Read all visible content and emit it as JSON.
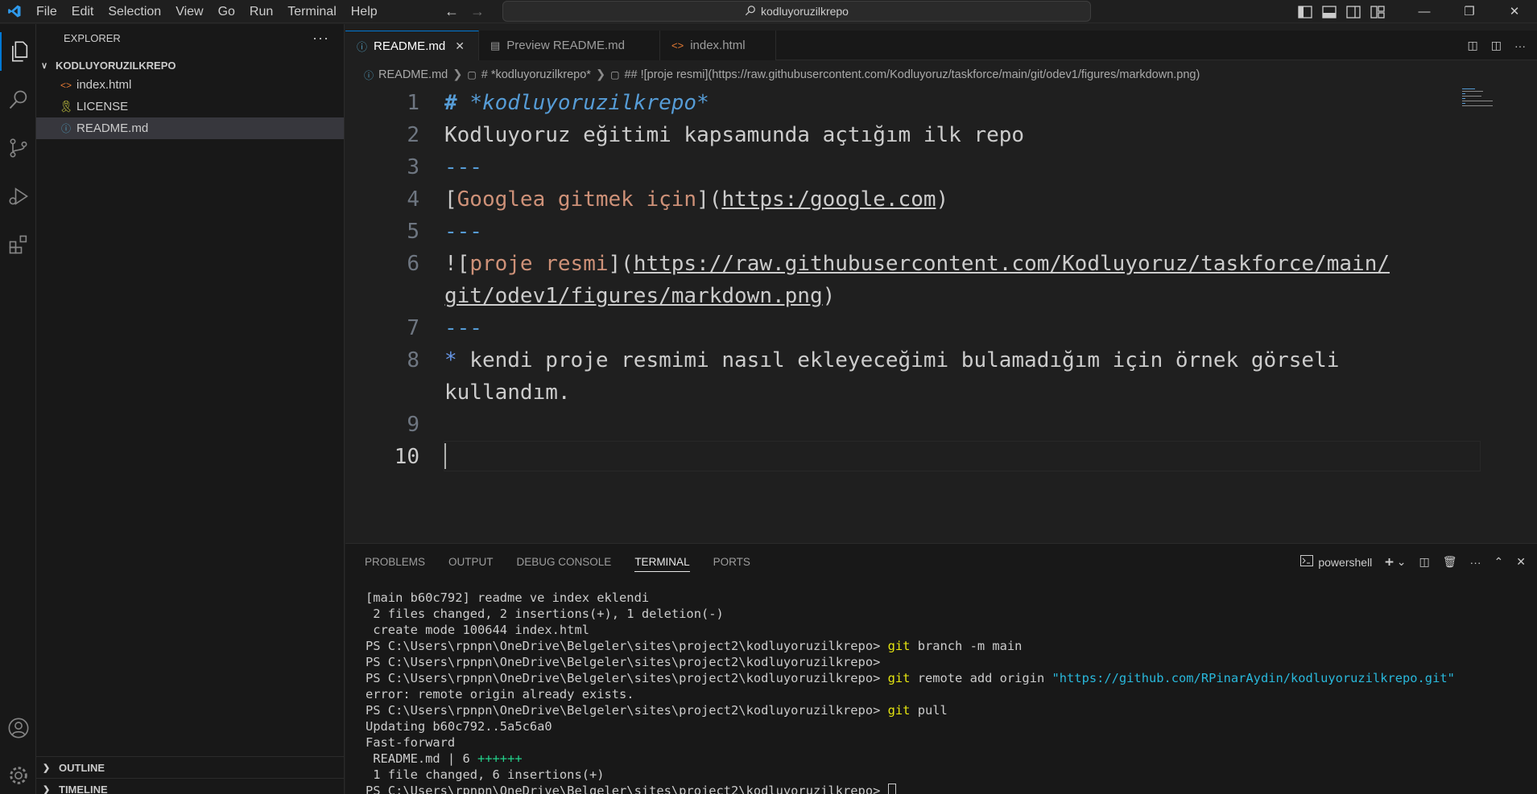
{
  "titlebar": {
    "menu": [
      "File",
      "Edit",
      "Selection",
      "View",
      "Go",
      "Run",
      "Terminal",
      "Help"
    ],
    "search_text": "kodluyoruzilkrepo",
    "icons": [
      "vscode-logo-icon",
      "arrow-left-icon",
      "arrow-right-icon",
      "search-icon",
      "toggle-primary-sidebar-icon",
      "toggle-panel-icon",
      "toggle-secondary-sidebar-icon",
      "customize-layout-icon",
      "minimize-icon",
      "restore-icon",
      "close-icon"
    ]
  },
  "activity_bar": {
    "items": [
      "explorer-icon",
      "search-icon",
      "source-control-icon",
      "run-debug-icon",
      "extensions-icon"
    ],
    "bottom": [
      "accounts-icon",
      "manage-gear-icon"
    ]
  },
  "sidebar": {
    "title": "EXPLORER",
    "folder": "KODLUYORUZILKREPO",
    "files": [
      {
        "name": "index.html",
        "icon": "html-file-icon",
        "color": "#e37933"
      },
      {
        "name": "LICENSE",
        "icon": "license-file-icon",
        "color": "#cbcb41"
      },
      {
        "name": "README.md",
        "icon": "info-file-icon",
        "color": "#519aba"
      }
    ],
    "outline": "OUTLINE",
    "timeline": "TIMELINE"
  },
  "tabs": [
    {
      "label": "README.md",
      "active": true
    },
    {
      "label": "Preview README.md",
      "active": false
    },
    {
      "label": "index.html",
      "active": false
    }
  ],
  "breadcrumb": [
    "README.md",
    "# *kodluyoruzilkrepo*",
    "## ![proje resmi](https://raw.githubusercontent.com/Kodluyoruz/taskforce/main/git/odev1/figures/markdown.png)"
  ],
  "editor": {
    "line_numbers": [
      "1",
      "2",
      "3",
      "4",
      "5",
      "6",
      "7",
      "8",
      "9",
      "10"
    ],
    "l1_hash": "#",
    "l1_title": "*kodluyoruzilkrepo*",
    "l2": "Kodluyoruz eğitimi kapsamunda açtığım ilk repo",
    "hr": "---",
    "l4_open": "[",
    "l4_text": "Googlea gitmek için",
    "l4_mid": "](",
    "l4_url": "https:/google.com",
    "l4_close": ")",
    "l6_open": "![",
    "l6_text": "proje resmi",
    "l6_mid": "](",
    "l6_url1": "https://raw.githubusercontent.com/Kodluyoruz/taskforce/main/",
    "l6_url2": "git/odev1/figures/markdown.png",
    "l6_close": ")",
    "l8_bullet": "*",
    "l8_text": " kendi proje resmimi nasıl ekleyeceğimi bulamadığım için örnek görseli",
    "l8_cont": "kullandım."
  },
  "panel": {
    "tabs": [
      "PROBLEMS",
      "OUTPUT",
      "DEBUG CONSOLE",
      "TERMINAL",
      "PORTS"
    ],
    "active_tab": "TERMINAL",
    "shell": "powershell",
    "prompt": "PS C:\\Users\\rpnpn\\OneDrive\\Belgeler\\sites\\project2\\kodluyoruzilkrepo> ",
    "lines": {
      "l1": "[main b60c792] readme ve index eklendi",
      "l2": " 2 files changed, 2 insertions(+), 1 deletion(-)",
      "l3": " create mode 100644 index.html",
      "cmd_branch_git": "git",
      "cmd_branch_rest": " branch -m main",
      "cmd_remote_git": "git",
      "cmd_remote_rest": " remote add origin ",
      "cmd_remote_url": "\"https://github.com/RPinarAydin/kodluyoruzilkrepo.git\"",
      "l8": "error: remote origin already exists.",
      "cmd_pull_git": "git",
      "cmd_pull_rest": " pull",
      "l10": "Updating b60c792..5a5c6a0",
      "l11": "Fast-forward",
      "l12_a": " README.md | 6 ",
      "l12_b": "++++++",
      "l13": " 1 file changed, 6 insertions(+)"
    }
  },
  "colors": {
    "accent": "#0078d4",
    "editor_bg": "#1f1f1f",
    "sidebar_bg": "#181818",
    "heading": "#569cd6",
    "link_text": "#ce9178"
  }
}
